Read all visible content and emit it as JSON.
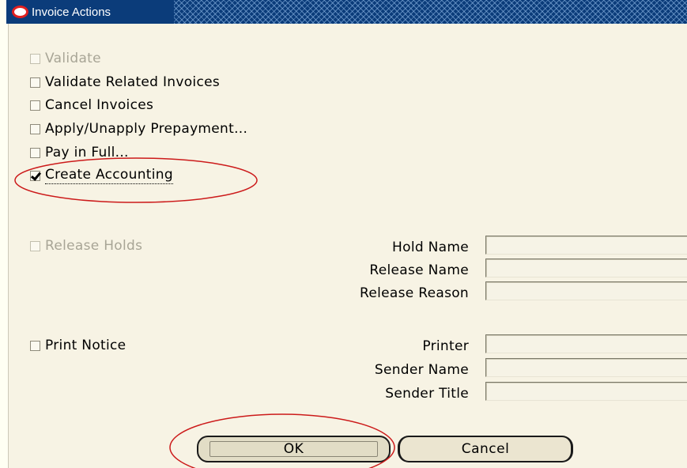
{
  "window": {
    "title": "Invoice Actions"
  },
  "actions": [
    {
      "label": "Validate",
      "checked": false,
      "enabled": false
    },
    {
      "label": "Validate Related Invoices",
      "checked": false,
      "enabled": true
    },
    {
      "label": "Cancel Invoices",
      "checked": false,
      "enabled": true
    },
    {
      "label": "Apply/Unapply Prepayment...",
      "checked": false,
      "enabled": true
    },
    {
      "label": "Pay in Full...",
      "checked": false,
      "enabled": true
    },
    {
      "label": "Create Accounting",
      "checked": true,
      "enabled": true
    }
  ],
  "release_holds": {
    "label": "Release Holds",
    "checked": false,
    "enabled": false,
    "fields": [
      {
        "label": "Hold Name",
        "value": ""
      },
      {
        "label": "Release Name",
        "value": ""
      },
      {
        "label": "Release Reason",
        "value": ""
      }
    ]
  },
  "print_notice": {
    "label": "Print Notice",
    "checked": false,
    "enabled": true,
    "fields": [
      {
        "label": "Printer",
        "value": ""
      },
      {
        "label": "Sender Name",
        "value": ""
      },
      {
        "label": "Sender Title",
        "value": ""
      }
    ]
  },
  "buttons": {
    "ok": "OK",
    "cancel": "Cancel"
  },
  "colors": {
    "titlebar": "#0b3c7a",
    "background": "#f7f3e4",
    "annotation": "#cc1a1a"
  },
  "icons": {
    "title": "oracle-icon"
  }
}
